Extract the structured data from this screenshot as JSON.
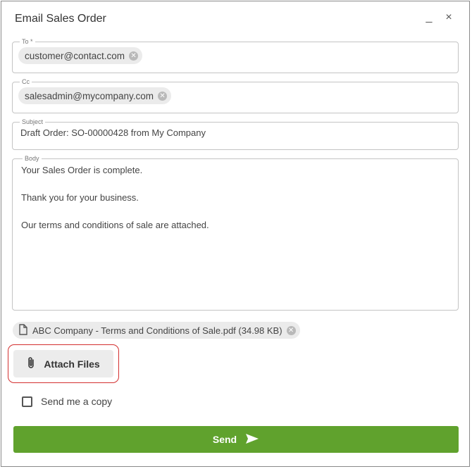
{
  "dialog": {
    "title": "Email Sales Order",
    "minimize_label": "_",
    "close_label": "×"
  },
  "to": {
    "label": "To *",
    "recipients": [
      "customer@contact.com"
    ]
  },
  "cc": {
    "label": "Cc",
    "recipients": [
      "salesadmin@mycompany.com"
    ]
  },
  "subject": {
    "label": "Subject",
    "value": "Draft Order: SO-00000428 from My Company"
  },
  "body": {
    "label": "Body",
    "lines": [
      "Your Sales Order is complete.",
      "Thank you for your business.",
      "Our terms and conditions of sale are attached."
    ]
  },
  "attachments": [
    {
      "name": "ABC Company - Terms and Conditions of Sale.pdf (34.98 KB)",
      "icon": "file-icon"
    }
  ],
  "attach_button": {
    "label": "Attach Files",
    "icon": "paperclip-icon"
  },
  "send_copy": {
    "label": "Send me a copy",
    "checked": false
  },
  "send_button": {
    "label": "Send",
    "icon": "send-arrow-icon"
  },
  "colors": {
    "send_green": "#60a22d",
    "highlight_red": "#d32f2f"
  }
}
